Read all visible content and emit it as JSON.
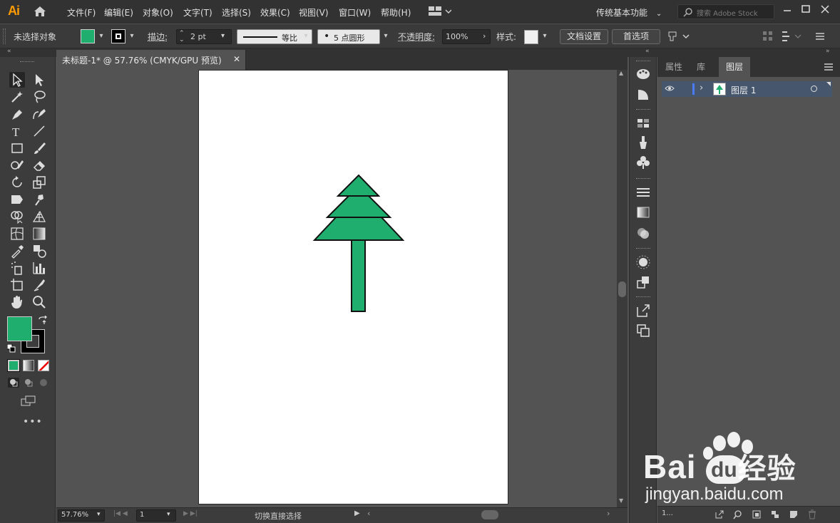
{
  "app": {
    "logo": "Ai"
  },
  "menu": [
    "文件(F)",
    "编辑(E)",
    "对象(O)",
    "文字(T)",
    "选择(S)",
    "效果(C)",
    "视图(V)",
    "窗口(W)",
    "帮助(H)"
  ],
  "workspace": "传统基本功能",
  "stock_search": {
    "placeholder": "搜索 Adobe Stock"
  },
  "control": {
    "selection_status": "未选择对象",
    "stroke_label": "描边",
    "stroke_weight": "2 pt",
    "stroke_profile": "等比",
    "brush": "5 点圆形",
    "opacity_label": "不透明度",
    "opacity_value": "100%",
    "style_label": "样式",
    "doc_setup": "文档设置",
    "preferences": "首选项"
  },
  "document_tab": {
    "title": "未标题-1* @ 57.76% (CMYK/GPU 预览)"
  },
  "status": {
    "zoom": "57.76%",
    "artboard": "1",
    "status_text": "切换直接选择"
  },
  "panel": {
    "tabs": [
      "属性",
      "库",
      "图层"
    ],
    "active_tab": "图层",
    "layers": [
      {
        "name": "图层 1"
      }
    ],
    "layer_count": "1..."
  },
  "colors": {
    "fill": "#1fae6e",
    "accent": "#ff9a00",
    "layer_highlight": "#46576d"
  },
  "watermark": {
    "brand_text": "Bai",
    "brand_text2": "经验",
    "url": "jingyan.baidu.com"
  }
}
